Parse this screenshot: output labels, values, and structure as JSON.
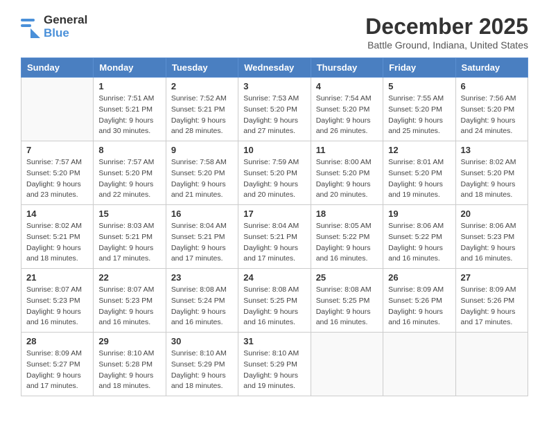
{
  "header": {
    "logo_general": "General",
    "logo_blue": "Blue",
    "month_title": "December 2025",
    "location": "Battle Ground, Indiana, United States"
  },
  "calendar": {
    "days_of_week": [
      "Sunday",
      "Monday",
      "Tuesday",
      "Wednesday",
      "Thursday",
      "Friday",
      "Saturday"
    ],
    "weeks": [
      [
        {
          "day": "",
          "info": ""
        },
        {
          "day": "1",
          "info": "Sunrise: 7:51 AM\nSunset: 5:21 PM\nDaylight: 9 hours\nand 30 minutes."
        },
        {
          "day": "2",
          "info": "Sunrise: 7:52 AM\nSunset: 5:21 PM\nDaylight: 9 hours\nand 28 minutes."
        },
        {
          "day": "3",
          "info": "Sunrise: 7:53 AM\nSunset: 5:20 PM\nDaylight: 9 hours\nand 27 minutes."
        },
        {
          "day": "4",
          "info": "Sunrise: 7:54 AM\nSunset: 5:20 PM\nDaylight: 9 hours\nand 26 minutes."
        },
        {
          "day": "5",
          "info": "Sunrise: 7:55 AM\nSunset: 5:20 PM\nDaylight: 9 hours\nand 25 minutes."
        },
        {
          "day": "6",
          "info": "Sunrise: 7:56 AM\nSunset: 5:20 PM\nDaylight: 9 hours\nand 24 minutes."
        }
      ],
      [
        {
          "day": "7",
          "info": "Sunrise: 7:57 AM\nSunset: 5:20 PM\nDaylight: 9 hours\nand 23 minutes."
        },
        {
          "day": "8",
          "info": "Sunrise: 7:57 AM\nSunset: 5:20 PM\nDaylight: 9 hours\nand 22 minutes."
        },
        {
          "day": "9",
          "info": "Sunrise: 7:58 AM\nSunset: 5:20 PM\nDaylight: 9 hours\nand 21 minutes."
        },
        {
          "day": "10",
          "info": "Sunrise: 7:59 AM\nSunset: 5:20 PM\nDaylight: 9 hours\nand 20 minutes."
        },
        {
          "day": "11",
          "info": "Sunrise: 8:00 AM\nSunset: 5:20 PM\nDaylight: 9 hours\nand 20 minutes."
        },
        {
          "day": "12",
          "info": "Sunrise: 8:01 AM\nSunset: 5:20 PM\nDaylight: 9 hours\nand 19 minutes."
        },
        {
          "day": "13",
          "info": "Sunrise: 8:02 AM\nSunset: 5:20 PM\nDaylight: 9 hours\nand 18 minutes."
        }
      ],
      [
        {
          "day": "14",
          "info": "Sunrise: 8:02 AM\nSunset: 5:21 PM\nDaylight: 9 hours\nand 18 minutes."
        },
        {
          "day": "15",
          "info": "Sunrise: 8:03 AM\nSunset: 5:21 PM\nDaylight: 9 hours\nand 17 minutes."
        },
        {
          "day": "16",
          "info": "Sunrise: 8:04 AM\nSunset: 5:21 PM\nDaylight: 9 hours\nand 17 minutes."
        },
        {
          "day": "17",
          "info": "Sunrise: 8:04 AM\nSunset: 5:21 PM\nDaylight: 9 hours\nand 17 minutes."
        },
        {
          "day": "18",
          "info": "Sunrise: 8:05 AM\nSunset: 5:22 PM\nDaylight: 9 hours\nand 16 minutes."
        },
        {
          "day": "19",
          "info": "Sunrise: 8:06 AM\nSunset: 5:22 PM\nDaylight: 9 hours\nand 16 minutes."
        },
        {
          "day": "20",
          "info": "Sunrise: 8:06 AM\nSunset: 5:23 PM\nDaylight: 9 hours\nand 16 minutes."
        }
      ],
      [
        {
          "day": "21",
          "info": "Sunrise: 8:07 AM\nSunset: 5:23 PM\nDaylight: 9 hours\nand 16 minutes."
        },
        {
          "day": "22",
          "info": "Sunrise: 8:07 AM\nSunset: 5:23 PM\nDaylight: 9 hours\nand 16 minutes."
        },
        {
          "day": "23",
          "info": "Sunrise: 8:08 AM\nSunset: 5:24 PM\nDaylight: 9 hours\nand 16 minutes."
        },
        {
          "day": "24",
          "info": "Sunrise: 8:08 AM\nSunset: 5:25 PM\nDaylight: 9 hours\nand 16 minutes."
        },
        {
          "day": "25",
          "info": "Sunrise: 8:08 AM\nSunset: 5:25 PM\nDaylight: 9 hours\nand 16 minutes."
        },
        {
          "day": "26",
          "info": "Sunrise: 8:09 AM\nSunset: 5:26 PM\nDaylight: 9 hours\nand 16 minutes."
        },
        {
          "day": "27",
          "info": "Sunrise: 8:09 AM\nSunset: 5:26 PM\nDaylight: 9 hours\nand 17 minutes."
        }
      ],
      [
        {
          "day": "28",
          "info": "Sunrise: 8:09 AM\nSunset: 5:27 PM\nDaylight: 9 hours\nand 17 minutes."
        },
        {
          "day": "29",
          "info": "Sunrise: 8:10 AM\nSunset: 5:28 PM\nDaylight: 9 hours\nand 18 minutes."
        },
        {
          "day": "30",
          "info": "Sunrise: 8:10 AM\nSunset: 5:29 PM\nDaylight: 9 hours\nand 18 minutes."
        },
        {
          "day": "31",
          "info": "Sunrise: 8:10 AM\nSunset: 5:29 PM\nDaylight: 9 hours\nand 19 minutes."
        },
        {
          "day": "",
          "info": ""
        },
        {
          "day": "",
          "info": ""
        },
        {
          "day": "",
          "info": ""
        }
      ]
    ]
  }
}
